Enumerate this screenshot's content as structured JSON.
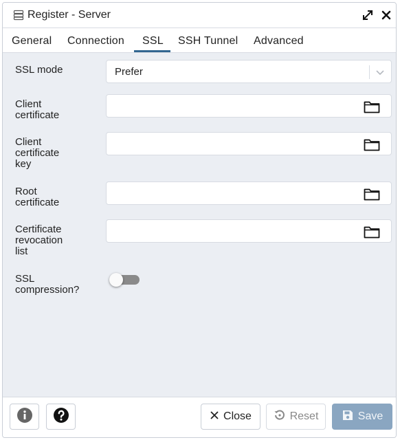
{
  "dialog": {
    "title": "Register - Server",
    "title_icon": "server-icon",
    "expand_icon": "expand-icon",
    "close_icon": "close-icon"
  },
  "tabs": [
    {
      "label": "General"
    },
    {
      "label": "Connection"
    },
    {
      "label": "SSL",
      "active": true
    },
    {
      "label": "SSH Tunnel"
    },
    {
      "label": "Advanced"
    }
  ],
  "form": {
    "ssl_mode": {
      "label": "SSL mode",
      "value": "Prefer",
      "icon": "chevron-down-icon"
    },
    "client_certificate": {
      "label_lines": [
        "Client",
        "certificate"
      ],
      "value": "",
      "icon": "folder-icon"
    },
    "client_certificate_key": {
      "label_lines": [
        "Client",
        "certificate",
        "key"
      ],
      "value": "",
      "icon": "folder-icon"
    },
    "root_certificate": {
      "label_lines": [
        "Root",
        "certificate"
      ],
      "value": "",
      "icon": "folder-icon"
    },
    "crl": {
      "label_lines": [
        "Certificate",
        "revocation",
        "list"
      ],
      "value": "",
      "icon": "folder-icon"
    },
    "ssl_compression": {
      "label_lines": [
        "SSL",
        "compression?"
      ],
      "enabled": false
    }
  },
  "footer": {
    "info_icon": "info-icon",
    "help_icon": "help-icon",
    "close_label": "Close",
    "reset_label": "Reset",
    "save_label": "Save"
  },
  "colors": {
    "accent": "#326690",
    "save_button": "#8aa6c1",
    "background": "#ebeef3"
  }
}
